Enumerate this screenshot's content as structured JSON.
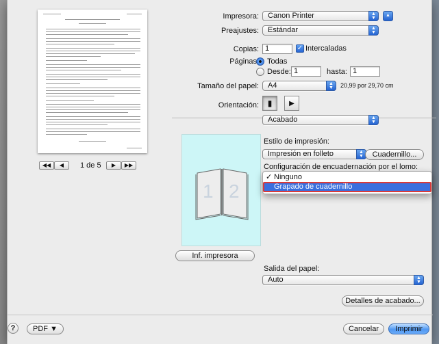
{
  "printer": {
    "label": "Impresora:",
    "value": "Canon Printer"
  },
  "presets": {
    "label": "Preajustes:",
    "value": "Estándar"
  },
  "copies": {
    "label": "Copias:",
    "value": "1",
    "collated_label": "Intercaladas"
  },
  "pages": {
    "label": "Páginas:",
    "all_label": "Todas",
    "from_label": "Desde:",
    "from_value": "1",
    "to_label": "hasta:",
    "to_value": "1"
  },
  "paper_size": {
    "label": "Tamaño del papel:",
    "value": "A4",
    "dimensions": "20,99 por 29,70 cm"
  },
  "orientation": {
    "label": "Orientación:"
  },
  "section": {
    "value": "Acabado"
  },
  "print_style": {
    "label": "Estilo de impresión:",
    "value": "Impresión en folleto",
    "button": "Cuadernillo..."
  },
  "binding": {
    "label": "Configuración de encuadernación por el lomo:",
    "options": [
      "Ninguno",
      "Grapado de cuadernillo"
    ],
    "checkmark": "✓"
  },
  "page_nav": {
    "text": "1 de 5"
  },
  "printer_info_button": "Inf. impresora",
  "paper_output": {
    "label": "Salida del papel:",
    "value": "Auto"
  },
  "finishing_details_button": "Detalles de acabado...",
  "bottom": {
    "help": "?",
    "pdf": "PDF ▼",
    "cancel": "Cancelar",
    "print": "Imprimir"
  },
  "preview_pages": [
    "1",
    "2"
  ],
  "colors": {
    "accent": "#3a6fde",
    "preview_bg": "#cdf6f7",
    "highlight_border": "#d83a3a"
  }
}
